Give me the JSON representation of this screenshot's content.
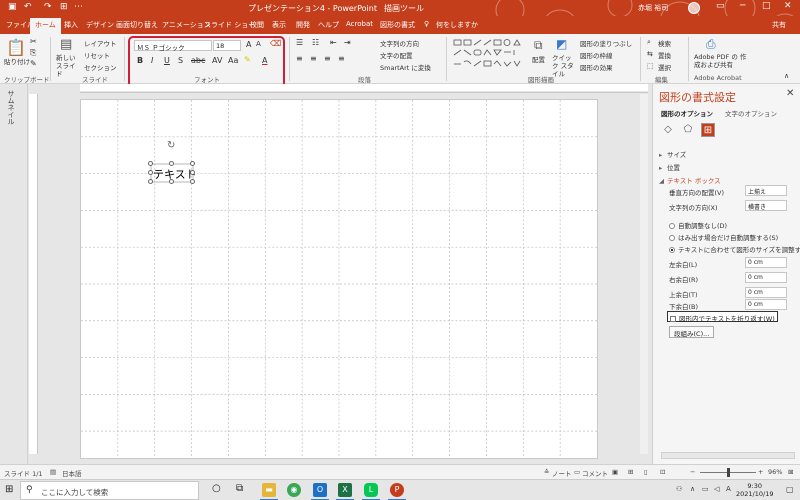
{
  "titlebar": {
    "title": "プレゼンテーション4 - PowerPoint",
    "context_label": "描画ツール",
    "user": "赤堀 裕司",
    "share": "共有"
  },
  "tabs": [
    {
      "label": "ファイル",
      "active": false
    },
    {
      "label": "ホーム",
      "active": true
    },
    {
      "label": "挿入",
      "active": false
    },
    {
      "label": "デザイン",
      "active": false
    },
    {
      "label": "画面切り替え",
      "active": false
    },
    {
      "label": "アニメーション",
      "active": false
    },
    {
      "label": "スライド ショー",
      "active": false
    },
    {
      "label": "校閲",
      "active": false
    },
    {
      "label": "表示",
      "active": false
    },
    {
      "label": "開発",
      "active": false
    },
    {
      "label": "ヘルプ",
      "active": false
    },
    {
      "label": "Acrobat",
      "active": false
    },
    {
      "label": "図形の書式",
      "active": false
    }
  ],
  "tell_me": "何をしますか",
  "ribbon": {
    "clipboard": {
      "paste": "貼り付け",
      "group": "クリップボード"
    },
    "slides": {
      "new_slide": "新しい スライド",
      "layout": "レイアウト",
      "reset": "リセット",
      "section": "セクション",
      "group": "スライド"
    },
    "font": {
      "font_name": "ＭＳ Ｐゴシック",
      "font_size": "18",
      "group": "フォント"
    },
    "paragraph": {
      "text_direction": "文字列の方向",
      "align_text": "文字の配置",
      "smartart": "SmartArt に変換",
      "group": "段落"
    },
    "drawing": {
      "arrange": "配置",
      "quick_styles": "クイック スタイル",
      "fill": "図形の塗りつぶし",
      "outline": "図形の枠線",
      "effects": "図形の効果",
      "group": "図形描画"
    },
    "editing": {
      "find": "検索",
      "replace": "置換",
      "select": "選択",
      "group": "編集"
    },
    "acrobat": {
      "create_pdf": "Adobe PDF の 作成および共有",
      "group": "Adobe Acrobat"
    }
  },
  "left_pane": {
    "label": "サムネイル"
  },
  "slide": {
    "shape_text": "テキスト"
  },
  "format_pane": {
    "title": "図形の書式設定",
    "tab_shape": "図形のオプション",
    "tab_text": "文字のオプション",
    "sections": {
      "size": "サイズ",
      "position": "位置",
      "textbox": "テキスト ボックス"
    },
    "vertical_align": {
      "label": "垂直方向の配置(V)",
      "value": "上揃え"
    },
    "text_direction": {
      "label": "文字列の方向(X)",
      "value": "横書き"
    },
    "autofit": [
      {
        "label": "自動調整なし(D)",
        "selected": false
      },
      {
        "label": "はみ出す場合だけ自動調整する(S)",
        "selected": false
      },
      {
        "label": "テキストに合わせて図形のサイズを調整する(",
        "selected": true
      }
    ],
    "margins": [
      {
        "label": "左余白(L)",
        "value": "0 cm"
      },
      {
        "label": "右余白(R)",
        "value": "0 cm"
      },
      {
        "label": "上余白(T)",
        "value": "0 cm"
      },
      {
        "label": "下余白(B)",
        "value": "0 cm"
      }
    ],
    "wrap_text": "図形内でテキストを折り返す(W)",
    "columns": "段組み(C)..."
  },
  "statusbar": {
    "slide": "スライド 1/1",
    "language": "日本語",
    "notes": "ノート",
    "comments": "コメント",
    "zoom": "96%"
  },
  "taskbar": {
    "search_placeholder": "ここに入力して検索",
    "time": "9:30",
    "date": "2021/10/19"
  },
  "colors": {
    "accent": "#c43e1c",
    "highlight": "#d01d38"
  }
}
